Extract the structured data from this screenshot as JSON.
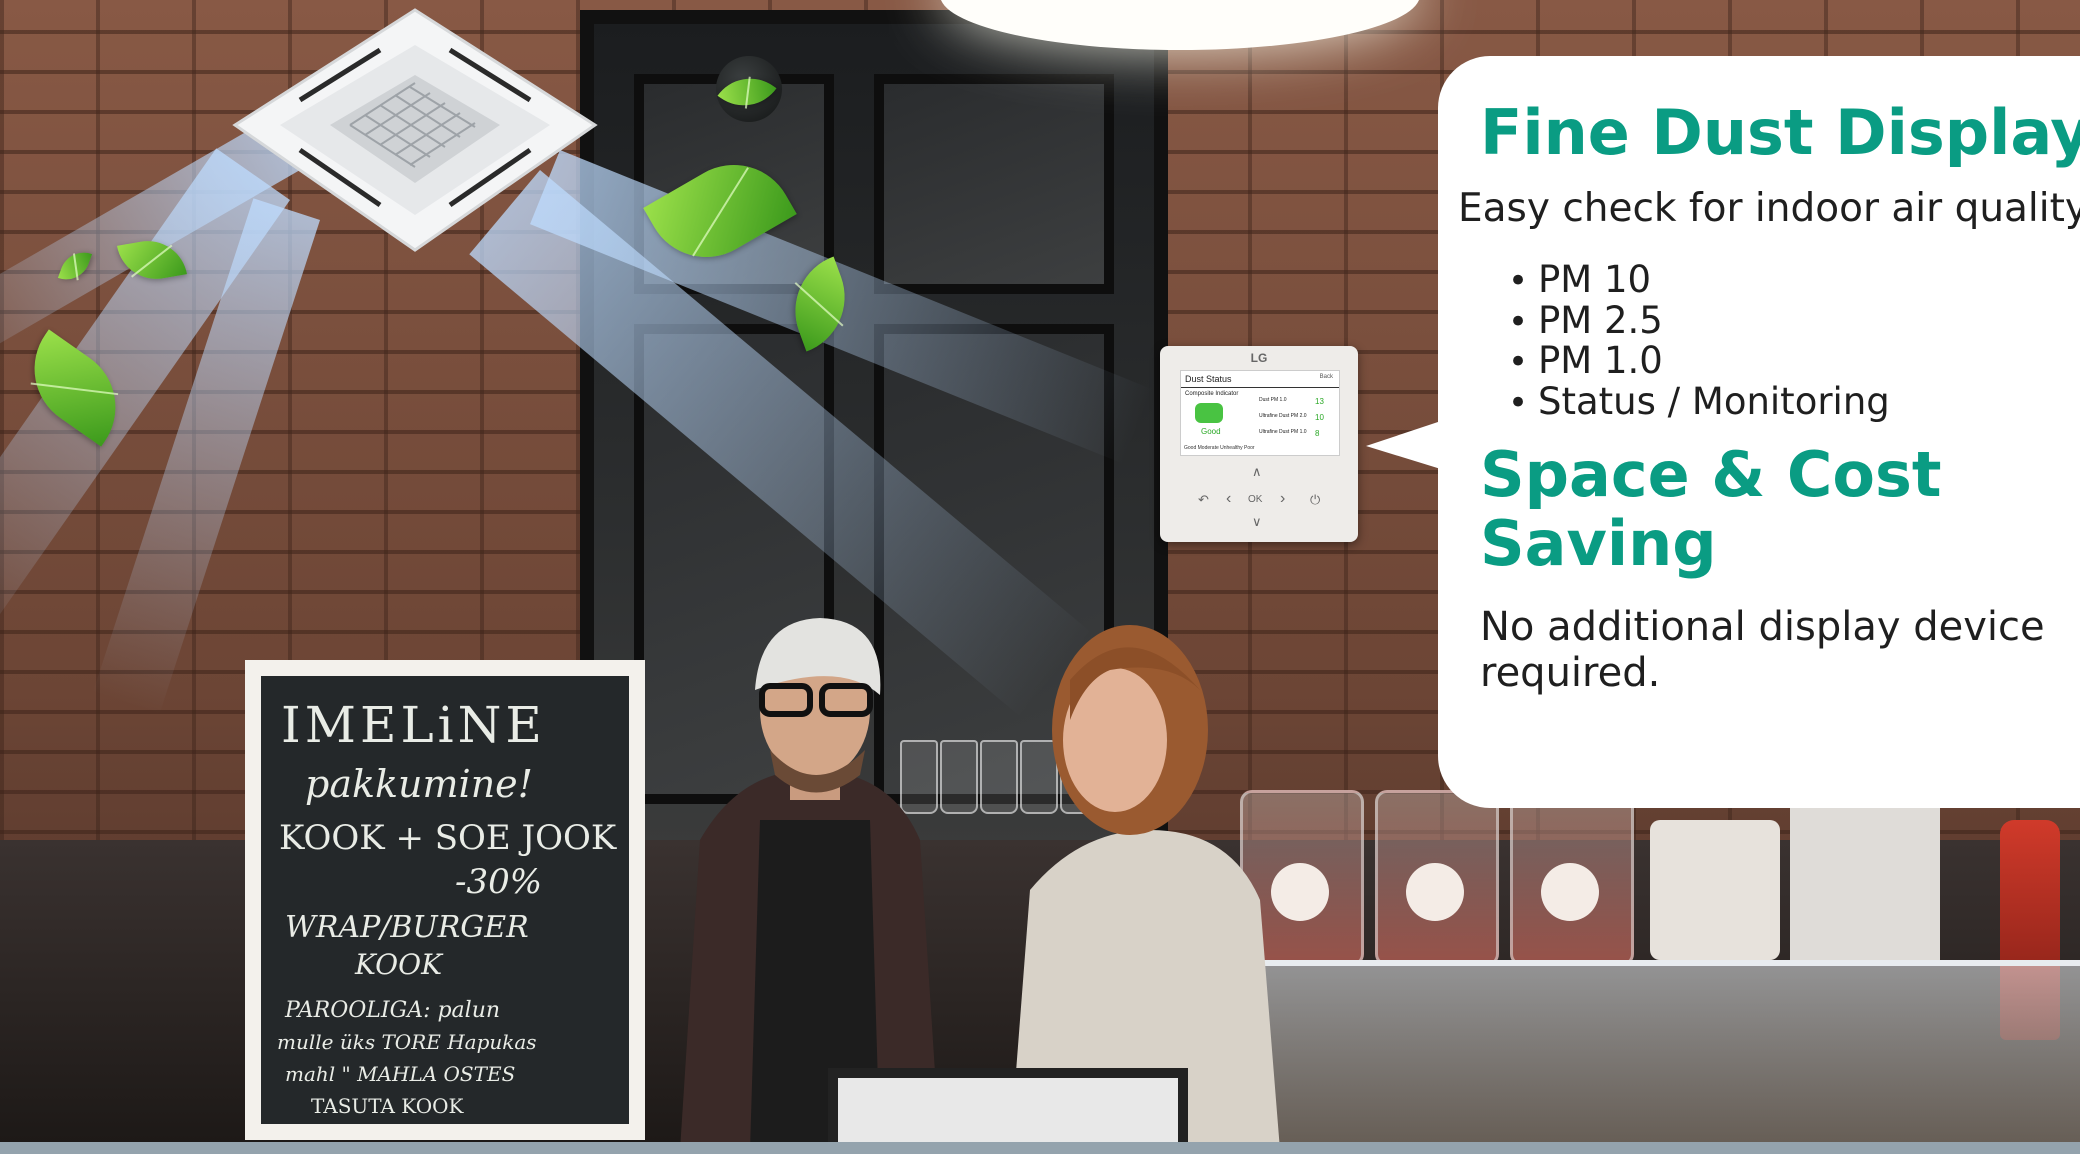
{
  "panel": {
    "heading": "Fine Dust Display",
    "subheading": "Easy check for indoor air quality",
    "bullets": [
      "PM 10",
      "PM 2.5",
      "PM 1.0",
      "Status / Monitoring"
    ],
    "heading2_line1": "Space & Cost",
    "heading2_line2": "Saving",
    "body": "No additional display device required."
  },
  "controller": {
    "brand": "LG",
    "screen_title": "Dust Status",
    "back_label": "Back",
    "composite_label": "Composite Indicator",
    "status": "Good",
    "rows": [
      {
        "label": "Dust PM 1.0",
        "value": "13"
      },
      {
        "label": "Ultrafine Dust PM 2.0",
        "value": "10"
      },
      {
        "label": "Ultrafine Dust PM 1.0",
        "value": "8"
      }
    ],
    "legend": "Good  Moderate  Unhealthy  Poor",
    "ok_label": "OK"
  },
  "chalkboard": {
    "lines": [
      "IMELiNE",
      "pakkumine!",
      "KOOK + SOE JOOK",
      "-30%",
      "WRAP/BURGER",
      "KOOK",
      "PAROOLIGA: palun",
      "mulle üks TORE Hapukas",
      "mahl \" MAHLA OSTES",
      "TASUTA KOOK"
    ]
  },
  "colors": {
    "accent": "#0a9c83",
    "text": "#1f1f1f",
    "leaf": "#6cc832",
    "panel": "#ffffff"
  },
  "icons": {
    "bullet": "•",
    "up": "∧",
    "down": "∨",
    "left": "‹",
    "right": "›",
    "back": "↶",
    "power": "⏻"
  }
}
